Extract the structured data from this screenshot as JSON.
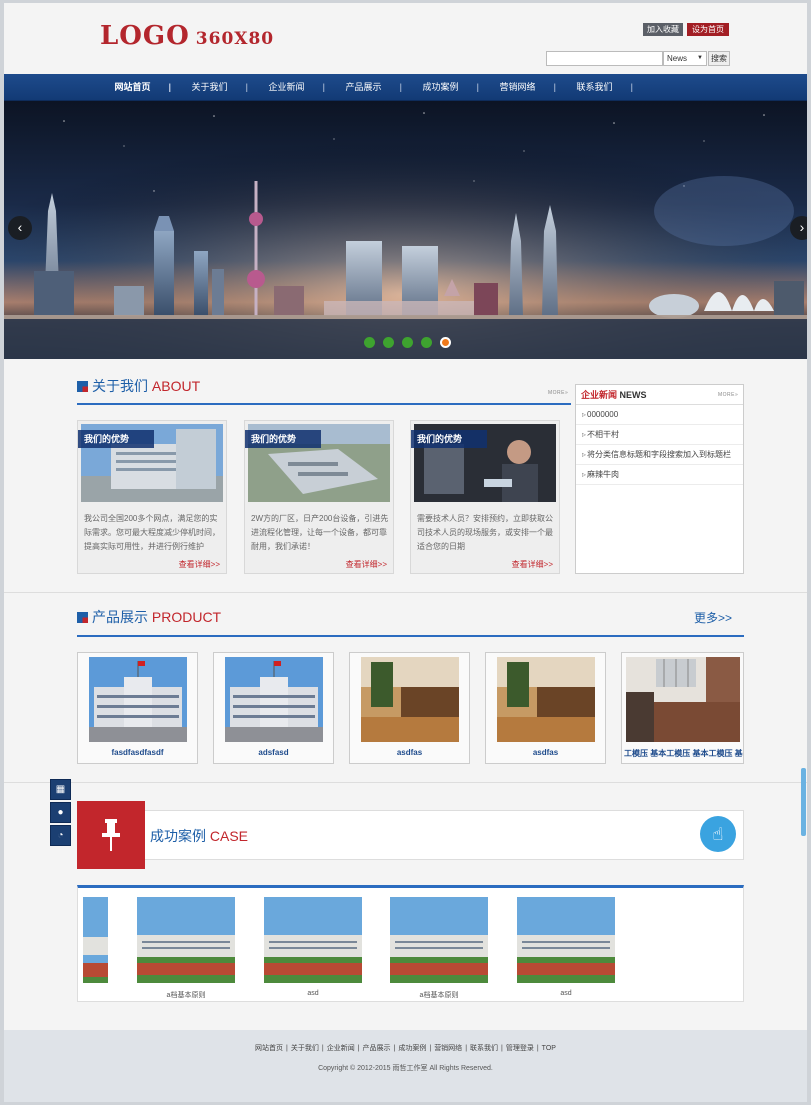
{
  "header": {
    "logo_main": "LOGO",
    "logo_size": "360X80",
    "add_favorite": "加入收藏",
    "set_homepage": "设为首页",
    "search_placeholder": "",
    "search_select": "News",
    "search_button": "搜索"
  },
  "nav": [
    {
      "label": "网站首页",
      "active": true
    },
    {
      "label": "关于我们"
    },
    {
      "label": "企业新闻"
    },
    {
      "label": "产品展示"
    },
    {
      "label": "成功案例"
    },
    {
      "label": "营销网络"
    },
    {
      "label": "联系我们"
    }
  ],
  "banner": {
    "prev": "‹",
    "next": "›",
    "slides": 5,
    "active_slide": 5
  },
  "about": {
    "title_cn": "关于我们",
    "title_en": "ABOUT",
    "more": "MORE»",
    "cards": [
      {
        "caption": "我们的优势",
        "text": "我公司全国200多个网点，满足您的实际需求。您可最大程度减少停机时间，提高实际可用性，并进行例行维护",
        "link": "查看详细>>"
      },
      {
        "caption": "我们的优势",
        "text": "2W方的厂区，日产200台设备，引进先进流程化管理，让每一个设备，都可靠耐用，我们承诺！",
        "link": "查看详细>>"
      },
      {
        "caption": "我们的优势",
        "text": "需要技术人员？安排预约，立即获取公司技术人员的现场服务，或安排一个最适合您的日期",
        "link": "查看详细>>"
      }
    ]
  },
  "news": {
    "title_cn": "企业新闻",
    "title_en": "NEWS",
    "more": "MORE»",
    "items": [
      "0000000",
      "不相干村",
      "将分类信息标题和字段搜索加入到标题栏",
      "麻辣牛肉"
    ]
  },
  "product": {
    "title_cn": "产品展示",
    "title_en": "PRODUCT",
    "more": "更多>>",
    "items": [
      "fasdfasdfasdf",
      "adsfasd",
      "asdfas",
      "asdfas",
      "工模压 基本工模压 基本工模压 基"
    ]
  },
  "case": {
    "title_cn": "成功案例",
    "title_en": "CASE",
    "items": [
      "a档基本原则",
      "asd",
      "a档基本原则",
      "asd"
    ]
  },
  "footer": {
    "links": [
      "网站首页",
      "关于我们",
      "企业新闻",
      "产品展示",
      "成功案例",
      "营销网络",
      "联系我们",
      "管理登录",
      "TOP"
    ],
    "copyright": "Copyright © 2012-2015 雨哲工作室 All Rights Reserved."
  }
}
